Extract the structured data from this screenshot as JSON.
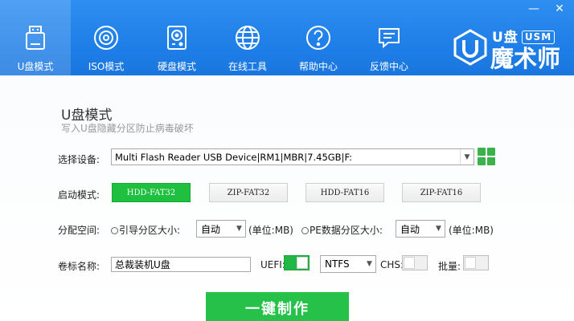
{
  "window": {
    "minimize_glyph": "—",
    "close_glyph": "✕"
  },
  "nav": {
    "items": [
      {
        "label": "U盘模式",
        "icon": "usb-drive-icon",
        "active": true
      },
      {
        "label": "ISO模式",
        "icon": "disc-icon",
        "active": false
      },
      {
        "label": "硬盘模式",
        "icon": "hard-disk-icon",
        "active": false
      },
      {
        "label": "在线工具",
        "icon": "globe-icon",
        "active": false
      },
      {
        "label": "帮助中心",
        "icon": "question-icon",
        "active": false
      },
      {
        "label": "反馈中心",
        "icon": "chat-bubble-icon",
        "active": false
      }
    ]
  },
  "logo": {
    "top": "U盘",
    "badge": "USM",
    "main": "魔术师"
  },
  "mode": {
    "title": "U盘模式",
    "subtitle": "写入U盘隐藏分区防止病毒破坏"
  },
  "device": {
    "label": "选择设备:",
    "value": "Multi Flash Reader USB Device|RM1|MBR|7.45GB|F:"
  },
  "boot": {
    "label": "启动模式:",
    "options": [
      "HDD-FAT32",
      "ZIP-FAT32",
      "HDD-FAT16",
      "ZIP-FAT16"
    ],
    "selected": "HDD-FAT32"
  },
  "partition": {
    "label": "分配空间:",
    "boot_size_label": "引导分区大小:",
    "boot_size_value": "自动",
    "boot_unit": "(单位:MB)",
    "pe_size_label": "PE数据分区大小:",
    "pe_size_value": "自动",
    "pe_unit": "(单位:MB)"
  },
  "volume": {
    "label": "卷标名称:",
    "value": "总裁装机U盘",
    "uefi_label": "UEFI:",
    "uefi_on": true,
    "fs_value": "NTFS",
    "chs_label": "CHS:",
    "chs_on": false,
    "batch_label": "批量:",
    "batch_on": false
  },
  "action": {
    "label": "一键制作"
  },
  "colors": {
    "header": "#1f7fe8",
    "accent_green": "#25c149"
  }
}
